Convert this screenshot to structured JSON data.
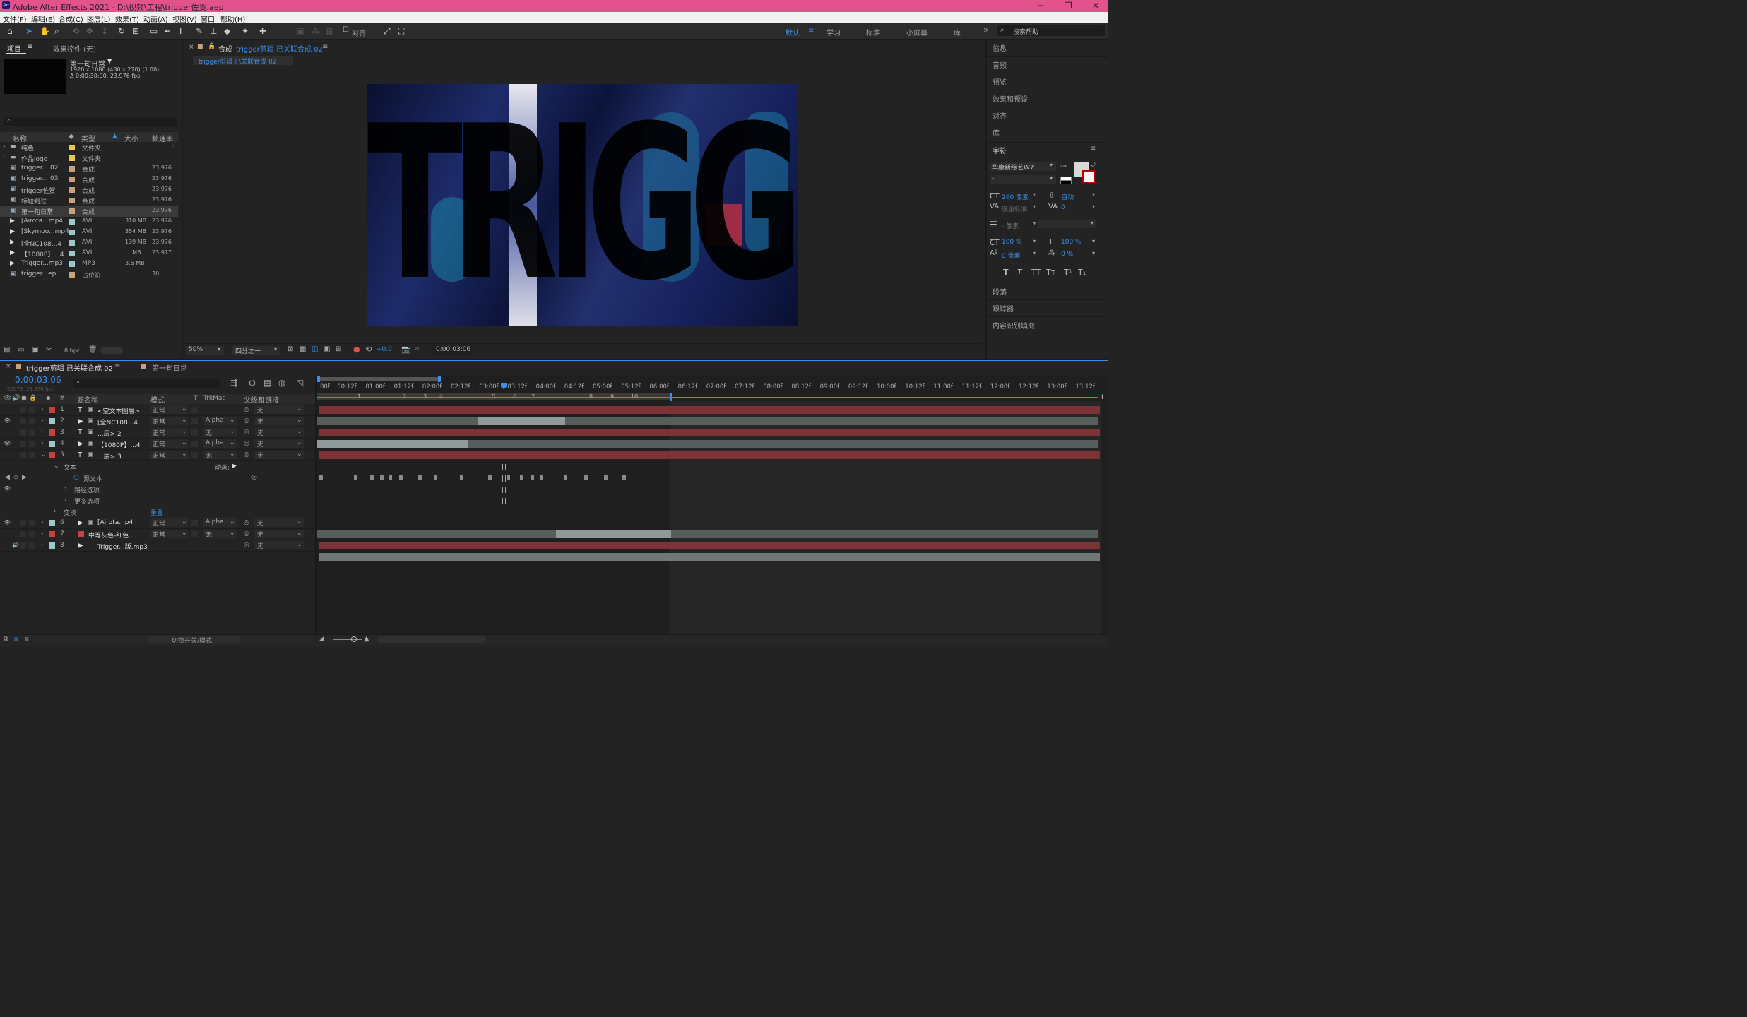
{
  "window": {
    "title": "Adobe After Effects 2021 - D:\\视频\\工程\\trigger佐贺.aep",
    "app_icon": "Ae"
  },
  "menu": [
    "文件(F)",
    "编辑(E)",
    "合成(C)",
    "图层(L)",
    "效果(T)",
    "动画(A)",
    "视图(V)",
    "窗口",
    "帮助(H)"
  ],
  "toolbar": {
    "align_label": "对齐"
  },
  "workspaces": [
    "默认",
    "学习",
    "标准",
    "小屏幕",
    "库"
  ],
  "search_help": {
    "placeholder": "搜索帮助"
  },
  "project": {
    "tab_project": "项目",
    "tab_effects": "效果控件 (无)",
    "selected_name": "第一句日常",
    "selected_info1": "1920 x 1080  (480 x 270) (1.00)",
    "selected_info2": "Δ 0:00:30:00, 23.976 fps",
    "headers": {
      "name": "名称",
      "type": "类型",
      "size": "大小",
      "fps": "帧速率"
    },
    "items": [
      {
        "name": "纯色",
        "type": "文件夹",
        "size": "",
        "fps": "",
        "color": "#e6c84a",
        "kind": "folder"
      },
      {
        "name": "作品logo",
        "type": "文件夹",
        "size": "",
        "fps": "",
        "color": "#e6c84a",
        "kind": "folder"
      },
      {
        "name": "trigger... 02",
        "type": "合成",
        "size": "",
        "fps": "23.976",
        "color": "#c7a27a",
        "kind": "comp"
      },
      {
        "name": "trigger... 03",
        "type": "合成",
        "size": "",
        "fps": "23.976",
        "color": "#c7a27a",
        "kind": "comp"
      },
      {
        "name": "trigger佐贺",
        "type": "合成",
        "size": "",
        "fps": "23.976",
        "color": "#c7a27a",
        "kind": "comp"
      },
      {
        "name": "标题划过",
        "type": "合成",
        "size": "",
        "fps": "23.976",
        "color": "#c7a27a",
        "kind": "comp"
      },
      {
        "name": "第一句日常",
        "type": "合成",
        "size": "",
        "fps": "23.976",
        "color": "#c7a27a",
        "kind": "comp"
      },
      {
        "name": "[Airota...mp4",
        "type": "AVI",
        "size": "310 MB",
        "fps": "23.976",
        "color": "#9cc9c9",
        "kind": "video"
      },
      {
        "name": "[Skymoo...mp4",
        "type": "AVI",
        "size": "354 MB",
        "fps": "23.976",
        "color": "#9cc9c9",
        "kind": "video"
      },
      {
        "name": "[全NC108...4",
        "type": "AVI",
        "size": "139 MB",
        "fps": "23.976",
        "color": "#9cc9c9",
        "kind": "video"
      },
      {
        "name": "【1080P】...4",
        "type": "AVI",
        "size": "... MB",
        "fps": "23.977",
        "color": "#9cc9c9",
        "kind": "video"
      },
      {
        "name": "Trigger...mp3",
        "type": "MP3",
        "size": "3.6 MB",
        "fps": "",
        "color": "#9cc9c9",
        "kind": "audio"
      },
      {
        "name": "trigger...ep",
        "type": "占位符",
        "size": "",
        "fps": "30",
        "color": "#c7a27a",
        "kind": "placeholder"
      }
    ],
    "bpc": "8 bpc"
  },
  "composition": {
    "tab_label": "合成",
    "tab_name": "trigger剪辑 已关联合成 02",
    "breadcrumb": "trigger剪辑 已关联合成 02",
    "preview_text": "TRIGGER",
    "zoom": "50%",
    "resolution": "四分之一",
    "exposure": "+0.0",
    "timecode": "0:00:03:06"
  },
  "right_panel": {
    "sections_top": [
      "信息",
      "音频",
      "预览",
      "效果和预设",
      "对齐",
      "库"
    ],
    "character_title": "字符",
    "font_name": "华康新综艺W7",
    "font_style": "-",
    "font_size": "260 像素",
    "leading": "自动",
    "kerning": "度量标准",
    "tracking": "0",
    "stroke_width": "- 像素",
    "vscale": "100 %",
    "hscale": "100 %",
    "baseline": "0 像素",
    "tsume": "0 %",
    "style_buttons": [
      "T",
      "T",
      "TT",
      "Tт",
      "T¹",
      "T₁"
    ],
    "sections_bottom": [
      "段落",
      "跟踪器",
      "内容识别填充"
    ]
  },
  "timeline": {
    "tab_active": "trigger剪辑 已关联合成 02",
    "tab_other": "第一句日常",
    "timecode": "0:00:03:06",
    "frame_info": "00078 (23.976 fps)",
    "col_headers": {
      "num": "#",
      "source": "源名称",
      "mode": "模式",
      "t": "T",
      "trkmat": "TrkMat",
      "parent": "父级和链接"
    },
    "ruler": [
      "00f",
      "00:12f",
      "01:00f",
      "01:12f",
      "02:00f",
      "02:12f",
      "03:00f",
      "03:12f",
      "04:00f",
      "04:12f",
      "05:00f",
      "05:12f",
      "06:00f",
      "06:12f",
      "07:00f",
      "07:12f",
      "08:00f",
      "08:12f",
      "09:00f",
      "09:12f",
      "10:00f",
      "10:12f",
      "11:00f",
      "11:12f",
      "12:00f",
      "12:12f",
      "13:00f",
      "13:12f"
    ],
    "markers": [
      "1",
      "2",
      "3",
      "4",
      "5",
      "6",
      "7",
      "8",
      "9",
      "10"
    ],
    "layers": [
      {
        "num": "1",
        "kind": "text",
        "name": "<空文本图层>",
        "mode": "正常",
        "trk": "",
        "parent": "无",
        "color": "#c94040",
        "eye": false
      },
      {
        "num": "2",
        "kind": "video",
        "name": "[全NC108...4",
        "mode": "正常",
        "trk": "Alpha",
        "parent": "无",
        "color": "#9cc9c9",
        "eye": true
      },
      {
        "num": "3",
        "kind": "text",
        "name": "...层> 2",
        "mode": "正常",
        "trk": "无",
        "parent": "无",
        "color": "#c94040",
        "eye": false
      },
      {
        "num": "4",
        "kind": "video",
        "name": "【1080P】...4",
        "mode": "正常",
        "trk": "Alpha",
        "parent": "无",
        "color": "#9cc9c9",
        "eye": true
      },
      {
        "num": "5",
        "kind": "text",
        "name": "...层> 3",
        "mode": "正常",
        "trk": "无",
        "parent": "无",
        "color": "#c94040",
        "eye": false
      }
    ],
    "sub_rows": {
      "text": "文本",
      "animate": "动画:",
      "source_text": "源文本",
      "path_options": "路径选项",
      "more_options": "更多选项",
      "transform": "变换",
      "reset": "重置"
    },
    "layers2": [
      {
        "num": "6",
        "kind": "video",
        "name": "[Airota...p4",
        "mode": "正常",
        "trk": "Alpha",
        "parent": "无",
        "color": "#9cc9c9",
        "eye": true
      },
      {
        "num": "7",
        "kind": "solid",
        "name": "中等灰色-红色...",
        "mode": "正常",
        "trk": "无",
        "parent": "无",
        "color": "#c94040",
        "eye": false
      },
      {
        "num": "8",
        "kind": "audio",
        "name": "Trigger...版.mp3",
        "mode": "",
        "trk": "",
        "parent": "无",
        "color": "#9cc9c9",
        "eye": false
      }
    ],
    "footer_toggle": "切换开关/模式"
  }
}
